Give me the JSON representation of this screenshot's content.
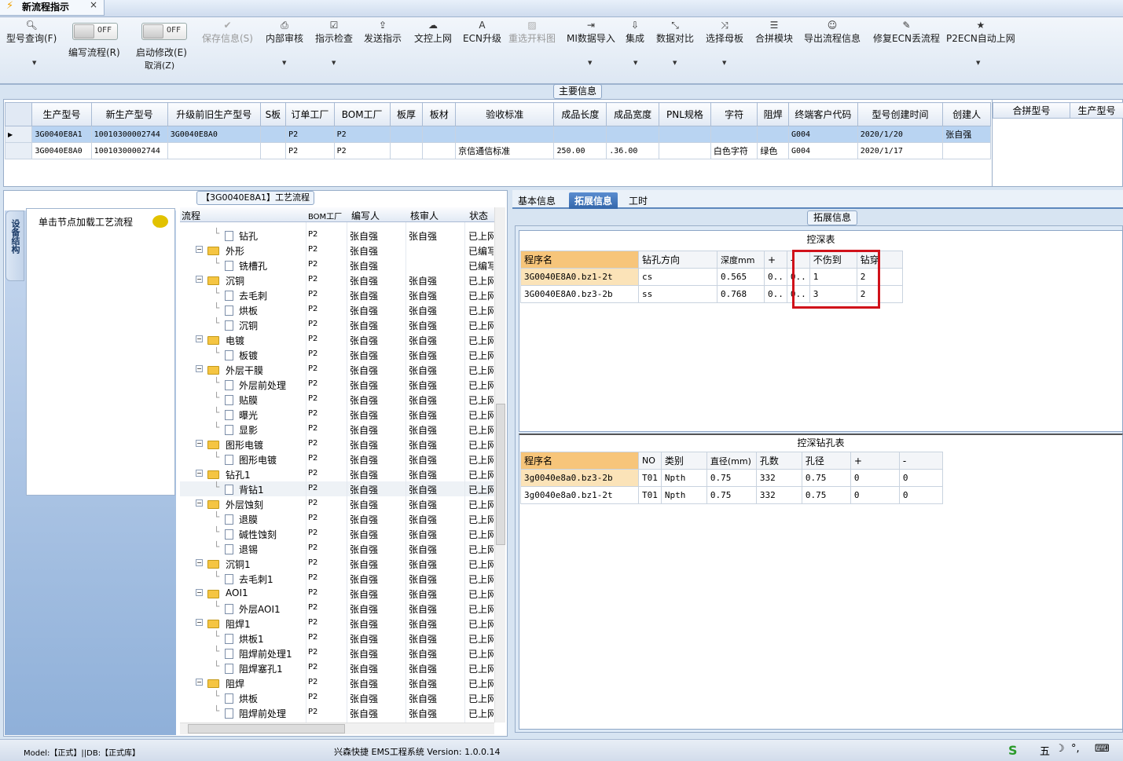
{
  "doc_tab": {
    "title": "新流程指示",
    "close": "×"
  },
  "toolbar": {
    "items": [
      {
        "label": "型号查询(F)",
        "icon": "Q"
      },
      {
        "label": "编写流程(R)",
        "icon": ""
      },
      {
        "label": "启动修改(E)",
        "label2": "取消(Z)",
        "icon": ""
      },
      {
        "label": "保存信息(S)",
        "icon": "✔"
      },
      {
        "label": "内部审核",
        "icon": "⎙"
      },
      {
        "label": "指示检查",
        "icon": "☑"
      },
      {
        "label": "发送指示",
        "icon": "⇪"
      },
      {
        "label": "文控上网",
        "icon": "☁"
      },
      {
        "label": "ECN升级",
        "icon": "A"
      },
      {
        "label": "重选开料图",
        "icon": "▨"
      },
      {
        "label": "MI数据导入",
        "icon": "⇥"
      },
      {
        "label": "集成",
        "icon": "⇩"
      },
      {
        "label": "数据对比",
        "icon": "⤡"
      },
      {
        "label": "选择母板",
        "icon": "⤨"
      },
      {
        "label": "合拼模块",
        "icon": "☰"
      },
      {
        "label": "导出流程信息",
        "icon": "☺"
      },
      {
        "label": "修复ECN丢流程",
        "icon": "✎"
      },
      {
        "label": "P2ECN自动上网",
        "icon": "★"
      }
    ],
    "toggle_off": "OFF"
  },
  "main_info": {
    "caption": "主要信息",
    "columns": [
      "生产型号",
      "新生产型号",
      "升级前旧生产型号",
      "S板",
      "订单工厂",
      "BOM工厂",
      "板厚",
      "板材",
      "验收标准",
      "成品长度",
      "成品宽度",
      "PNL规格",
      "字符",
      "阻焊",
      "终端客户代码",
      "型号创建时间",
      "创建人"
    ],
    "rows": [
      [
        "3G0040E8A1",
        "10010300002744",
        "3G0040E8A0",
        "",
        "P2",
        "P2",
        "",
        "",
        "",
        "",
        "",
        "",
        "",
        "",
        "G004",
        "2020/1/20",
        "张自强"
      ],
      [
        "3G0040E8A0",
        "10010300002744",
        "",
        "",
        "P2",
        "P2",
        "",
        "",
        "京信通信标准",
        "250.00",
        ".36.00",
        "",
        "白色字符",
        "绿色",
        "G004",
        "2020/1/17",
        ""
      ]
    ],
    "right_columns": [
      "合拼型号",
      "生产型号"
    ]
  },
  "left_panel": {
    "vertical_tab": "设备结构",
    "hint": "单击节点加载工艺流程",
    "tree_caption": "【3G0040E8A1】工艺流程",
    "tree_columns": [
      "流程",
      "BOM工厂",
      "编写人",
      "核审人",
      "状态"
    ]
  },
  "tree_rows": [
    {
      "lvl": 2,
      "name": "钻孔",
      "f": "P2",
      "w": "张自强",
      "r": "张自强",
      "s": "已上网"
    },
    {
      "lvl": 1,
      "name": "外形",
      "f": "P2",
      "w": "张自强",
      "r": "",
      "s": "已编写"
    },
    {
      "lvl": 2,
      "name": "铣槽孔",
      "f": "P2",
      "w": "张自强",
      "r": "",
      "s": "已编写"
    },
    {
      "lvl": 1,
      "name": "沉铜",
      "f": "P2",
      "w": "张自强",
      "r": "张自强",
      "s": "已上网"
    },
    {
      "lvl": 2,
      "name": "去毛刺",
      "f": "P2",
      "w": "张自强",
      "r": "张自强",
      "s": "已上网"
    },
    {
      "lvl": 2,
      "name": "烘板",
      "f": "P2",
      "w": "张自强",
      "r": "张自强",
      "s": "已上网"
    },
    {
      "lvl": 2,
      "name": "沉铜",
      "f": "P2",
      "w": "张自强",
      "r": "张自强",
      "s": "已上网"
    },
    {
      "lvl": 1,
      "name": "电镀",
      "f": "P2",
      "w": "张自强",
      "r": "张自强",
      "s": "已上网"
    },
    {
      "lvl": 2,
      "name": "板镀",
      "f": "P2",
      "w": "张自强",
      "r": "张自强",
      "s": "已上网"
    },
    {
      "lvl": 1,
      "name": "外层干膜",
      "f": "P2",
      "w": "张自强",
      "r": "张自强",
      "s": "已上网"
    },
    {
      "lvl": 2,
      "name": "外层前处理",
      "f": "P2",
      "w": "张自强",
      "r": "张自强",
      "s": "已上网"
    },
    {
      "lvl": 2,
      "name": "贴膜",
      "f": "P2",
      "w": "张自强",
      "r": "张自强",
      "s": "已上网"
    },
    {
      "lvl": 2,
      "name": "曝光",
      "f": "P2",
      "w": "张自强",
      "r": "张自强",
      "s": "已上网"
    },
    {
      "lvl": 2,
      "name": "显影",
      "f": "P2",
      "w": "张自强",
      "r": "张自强",
      "s": "已上网"
    },
    {
      "lvl": 1,
      "name": "图形电镀",
      "f": "P2",
      "w": "张自强",
      "r": "张自强",
      "s": "已上网"
    },
    {
      "lvl": 2,
      "name": "图形电镀",
      "f": "P2",
      "w": "张自强",
      "r": "张自强",
      "s": "已上网"
    },
    {
      "lvl": 1,
      "name": "钻孔1",
      "f": "P2",
      "w": "张自强",
      "r": "张自强",
      "s": "已上网"
    },
    {
      "lvl": 2,
      "name": "背钻1",
      "f": "P2",
      "w": "张自强",
      "r": "张自强",
      "s": "已上网",
      "hl": true
    },
    {
      "lvl": 1,
      "name": "外层蚀刻",
      "f": "P2",
      "w": "张自强",
      "r": "张自强",
      "s": "已上网"
    },
    {
      "lvl": 2,
      "name": "退膜",
      "f": "P2",
      "w": "张自强",
      "r": "张自强",
      "s": "已上网"
    },
    {
      "lvl": 2,
      "name": "碱性蚀刻",
      "f": "P2",
      "w": "张自强",
      "r": "张自强",
      "s": "已上网"
    },
    {
      "lvl": 2,
      "name": "退锡",
      "f": "P2",
      "w": "张自强",
      "r": "张自强",
      "s": "已上网"
    },
    {
      "lvl": 1,
      "name": "沉铜1",
      "f": "P2",
      "w": "张自强",
      "r": "张自强",
      "s": "已上网"
    },
    {
      "lvl": 2,
      "name": "去毛刺1",
      "f": "P2",
      "w": "张自强",
      "r": "张自强",
      "s": "已上网"
    },
    {
      "lvl": 1,
      "name": "AOI1",
      "f": "P2",
      "w": "张自强",
      "r": "张自强",
      "s": "已上网"
    },
    {
      "lvl": 2,
      "name": "外层AOI1",
      "f": "P2",
      "w": "张自强",
      "r": "张自强",
      "s": "已上网"
    },
    {
      "lvl": 1,
      "name": "阻焊1",
      "f": "P2",
      "w": "张自强",
      "r": "张自强",
      "s": "已上网"
    },
    {
      "lvl": 2,
      "name": "烘板1",
      "f": "P2",
      "w": "张自强",
      "r": "张自强",
      "s": "已上网"
    },
    {
      "lvl": 2,
      "name": "阻焊前处理1",
      "f": "P2",
      "w": "张自强",
      "r": "张自强",
      "s": "已上网"
    },
    {
      "lvl": 2,
      "name": "阻焊塞孔1",
      "f": "P2",
      "w": "张自强",
      "r": "张自强",
      "s": "已上网"
    },
    {
      "lvl": 1,
      "name": "阻焊",
      "f": "P2",
      "w": "张自强",
      "r": "张自强",
      "s": "已上网"
    },
    {
      "lvl": 2,
      "name": "烘板",
      "f": "P2",
      "w": "张自强",
      "r": "张自强",
      "s": "已上网"
    },
    {
      "lvl": 2,
      "name": "阻焊前处理",
      "f": "P2",
      "w": "张自强",
      "r": "张自强",
      "s": "已上网"
    }
  ],
  "right_panel": {
    "tabs": [
      "基本信息",
      "拓展信息",
      "工时"
    ],
    "active_tab": 1,
    "caption": "拓展信息",
    "kst": {
      "title": "控深表",
      "columns": [
        "程序名",
        "钻孔方向",
        "深度mm",
        "+",
        "-",
        "不伤到",
        "钻穿"
      ],
      "rows": [
        [
          "3G0040E8A0.bz1-2t",
          "cs",
          "0.565",
          "0..",
          "0..",
          "1",
          "2"
        ],
        [
          "3G0040E8A0.bz3-2b",
          "ss",
          "0.768",
          "0..",
          "0..",
          "3",
          "2"
        ]
      ]
    },
    "kzk": {
      "title": "控深钻孔表",
      "columns": [
        "程序名",
        "NO",
        "类别",
        "直径(mm)",
        "孔数",
        "孔径",
        "+",
        "-"
      ],
      "rows": [
        [
          "3g0040e8a0.bz3-2b",
          "T01",
          "Npth",
          "0.75",
          "332",
          "0.75",
          "0",
          "0"
        ],
        [
          "3g0040e8a0.bz1-2t",
          "T01",
          "Npth",
          "0.75",
          "332",
          "0.75",
          "0",
          "0"
        ]
      ]
    }
  },
  "status": {
    "left": "Model:【正式】||DB:【正式库】",
    "center": "兴森快捷 EMS工程系统 Version: 1.0.0.14",
    "ime": "五"
  }
}
